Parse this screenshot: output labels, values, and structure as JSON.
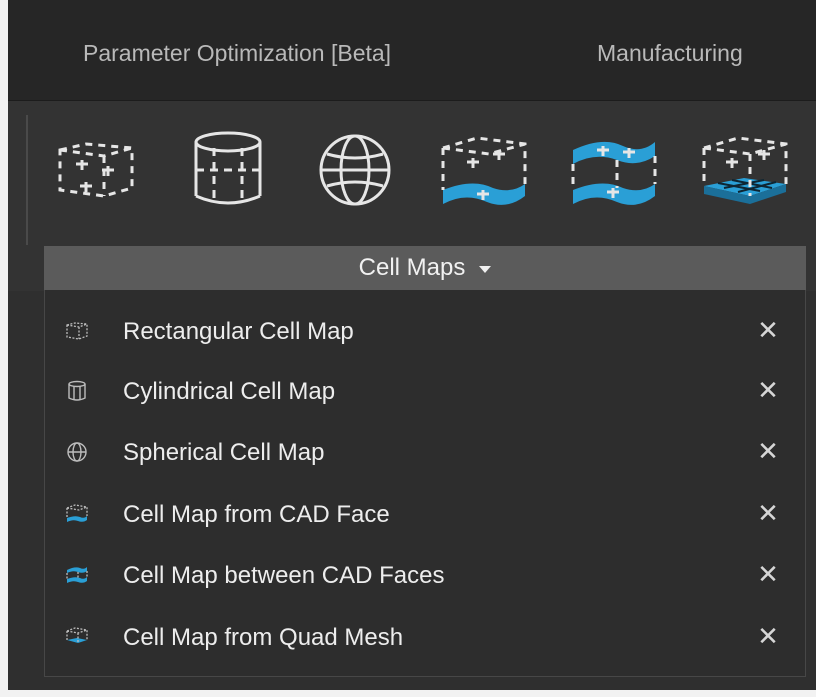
{
  "tabs": [
    {
      "label": "Parameter Optimization [Beta]"
    },
    {
      "label": "Manufacturing"
    }
  ],
  "ribbon": {
    "tools": [
      {
        "icon": "rectangular-cell-map-icon"
      },
      {
        "icon": "cylindrical-cell-map-icon"
      },
      {
        "icon": "spherical-cell-map-icon"
      },
      {
        "icon": "cell-map-from-cad-face-icon"
      },
      {
        "icon": "cell-map-between-cad-faces-icon"
      },
      {
        "icon": "cell-map-from-quad-mesh-icon"
      }
    ],
    "group_label": "Cell Maps"
  },
  "menu": {
    "items": [
      {
        "label": "Rectangular Cell Map",
        "icon": "rectangular-cell-map-icon",
        "close": "✕"
      },
      {
        "label": "Cylindrical Cell Map",
        "icon": "cylindrical-cell-map-icon",
        "close": "✕"
      },
      {
        "label": "Spherical Cell Map",
        "icon": "spherical-cell-map-icon",
        "close": "✕"
      },
      {
        "label": "Cell Map from CAD Face",
        "icon": "cell-map-from-cad-face-icon",
        "close": "✕"
      },
      {
        "label": "Cell Map between CAD Faces",
        "icon": "cell-map-between-cad-faces-icon",
        "close": "✕"
      },
      {
        "label": "Cell Map from Quad Mesh",
        "icon": "cell-map-from-quad-mesh-icon",
        "close": "✕"
      }
    ]
  },
  "colors": {
    "accent_blue": "#2a9fd6",
    "panel_dark": "#2d2d2d",
    "label_bar": "#5b5b5b"
  }
}
